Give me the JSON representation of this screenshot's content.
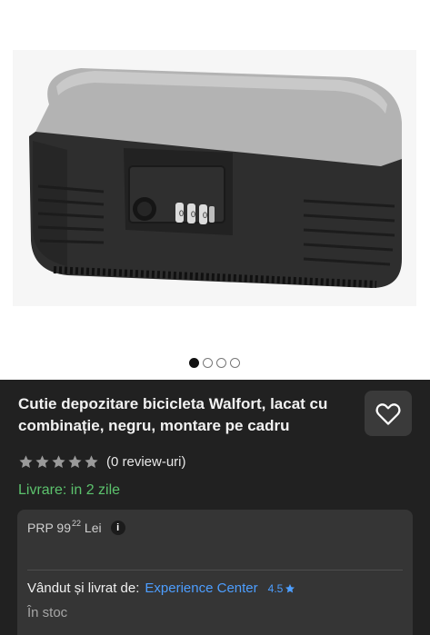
{
  "gallery": {
    "slides_total": 4,
    "active_slide": 1
  },
  "product": {
    "title": "Cutie depozitare bicicleta Walfort, lacat cu combinație, negru, montare pe cadru",
    "rating_stars_filled": 0,
    "rating_stars_total": 5,
    "review_count_label": "(0 review-uri)",
    "delivery_label": "Livrare: in 2 zile"
  },
  "offer": {
    "prp_prefix": "PRP 99",
    "prp_cents": "22",
    "prp_currency": "Lei",
    "info_icon_glyph": "i",
    "seller_prefix": "Vândut și livrat de:",
    "seller_name": "Experience Center",
    "seller_rating": "4.5",
    "stock_label": "În stoc"
  },
  "icons": {
    "favorite": "heart-outline-icon",
    "star": "star-icon",
    "info": "info-icon"
  },
  "colors": {
    "panel_bg": "#212121",
    "card_bg": "#353535",
    "delivery_green": "#5cc26d",
    "link_blue": "#4d9eff",
    "star_empty": "#9a9a9a"
  }
}
